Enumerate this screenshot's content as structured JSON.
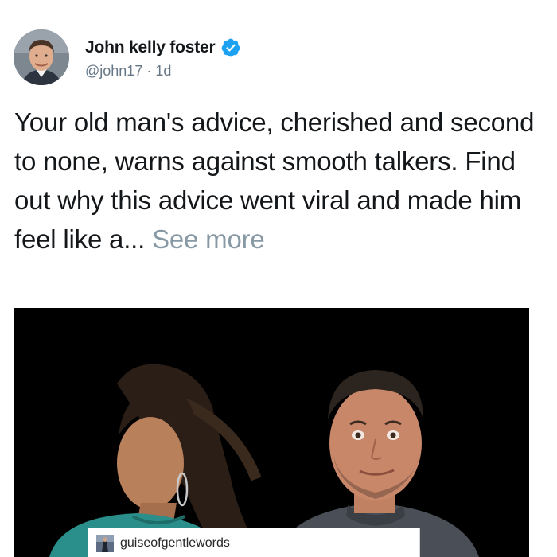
{
  "post": {
    "author": {
      "display_name": "John kelly foster",
      "handle": "@john17",
      "separator": " · ",
      "time": "1d",
      "verified": true,
      "avatar_icon": "profile-photo"
    },
    "text": "Your old man's advice, cherished and second to none, warns against smooth talkers. Find out why this advice went viral and made him feel like a... ",
    "see_more_label": "See more",
    "media": {
      "image_icon": "photo-woman-and-man",
      "caption_username": "guiseofgentlewords"
    }
  },
  "colors": {
    "verified_badge": "#1da1f2",
    "primary_text": "#14171a",
    "secondary_text": "#657786",
    "see_more": "#8899a6",
    "media_background": "#000000"
  }
}
